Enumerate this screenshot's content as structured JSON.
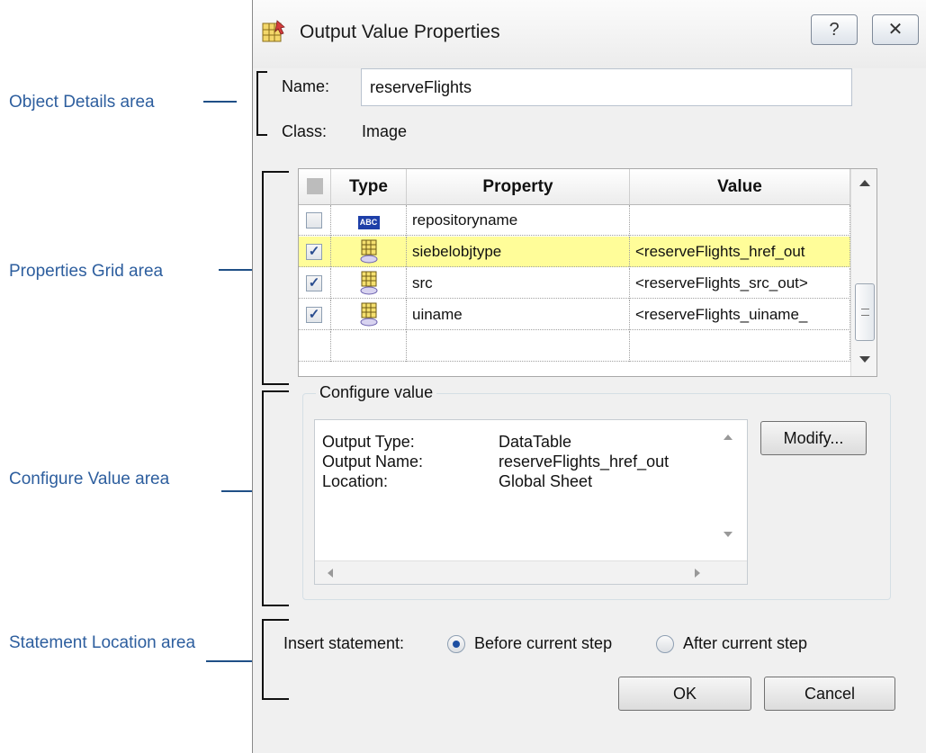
{
  "annotations": {
    "object_details": "Object Details area",
    "properties_grid": "Properties Grid area",
    "configure_value": "Configure Value area",
    "statement_location": "Statement Location area"
  },
  "dialog": {
    "title": "Output Value Properties",
    "help_glyph": "?",
    "close_glyph": "✕"
  },
  "object_details": {
    "name_label": "Name:",
    "name_value": "reserveFlights",
    "class_label": "Class:",
    "class_value": "Image"
  },
  "grid": {
    "headers": [
      "Type",
      "Property",
      "Value"
    ],
    "rows": [
      {
        "checked": false,
        "type_icon": "abc-text-icon",
        "property": "repositoryname",
        "value": "",
        "selected": false
      },
      {
        "checked": true,
        "type_icon": "datatable-output-icon",
        "property": "siebelobjtype",
        "value": "<reserveFlights_href_out",
        "selected": true
      },
      {
        "checked": true,
        "type_icon": "datatable-output-icon",
        "property": "src",
        "value": "<reserveFlights_src_out>",
        "selected": false
      },
      {
        "checked": true,
        "type_icon": "datatable-output-icon",
        "property": "uiname",
        "value": "<reserveFlights_uiname_",
        "selected": false
      }
    ]
  },
  "configure": {
    "group_title": "Configure value",
    "output_type_label": "Output Type:",
    "output_type_value": "DataTable",
    "output_name_label": "Output Name:",
    "output_name_value": "reserveFlights_href_out",
    "location_label": "Location:",
    "location_value": "Global Sheet",
    "modify_button": "Modify..."
  },
  "statement": {
    "insert_label": "Insert statement:",
    "before_option": "Before current step",
    "after_option": "After current step",
    "selected": "before"
  },
  "footer": {
    "ok": "OK",
    "cancel": "Cancel"
  },
  "colors": {
    "annotation_text": "#2d5e9e",
    "selected_row": "#fffd99"
  }
}
